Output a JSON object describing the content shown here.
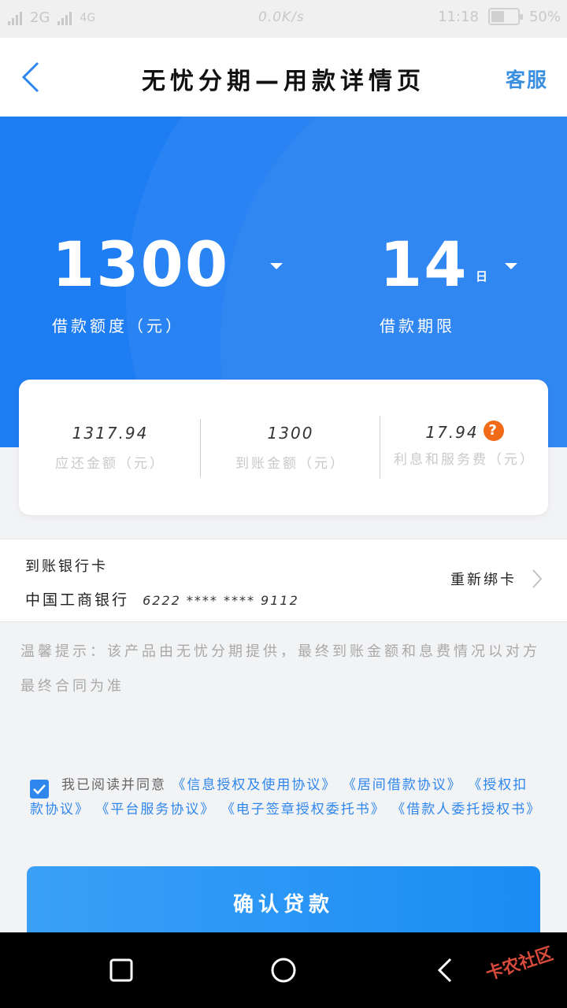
{
  "status_bar": {
    "network_2g": "2G",
    "network_4g": "4G",
    "speed": "0.0K/s",
    "time": "11:18",
    "battery_pct": "50%",
    "battery_level": 0.5
  },
  "nav": {
    "title": "无忧分期—用款详情页",
    "service": "客服",
    "back_icon": "chevron-left-icon"
  },
  "hero": {
    "amount_value": "1300",
    "amount_label": "借款额度（元）",
    "term_value": "14",
    "term_unit": "日",
    "term_label": "借款期限"
  },
  "summary": [
    {
      "value": "1317.94",
      "label": "应还金额（元）"
    },
    {
      "value": "1300",
      "label": "到账金额（元）"
    },
    {
      "value": "17.94",
      "label": "利息和服务费（元）",
      "help": "?"
    }
  ],
  "bank": {
    "title": "到账银行卡",
    "bank_name": "中国工商银行",
    "card_no": "6222 **** **** 9112",
    "rebind": "重新绑卡"
  },
  "tip": "温馨提示：该产品由无忧分期提供，最终到账金额和息费情况以对方最终合同为准",
  "agreement": {
    "checked": true,
    "prefix": "我已阅读并同意",
    "links": [
      "《信息授权及使用协议》",
      "《居间借款协议》",
      "《授权扣款协议》",
      "《平台服务协议》",
      "《电子签章授权委托书》",
      "《借款人委托授权书》"
    ]
  },
  "confirm_button": "确认贷款",
  "watermark": "卡农社区",
  "colors": {
    "primary": "#1e7df2",
    "link": "#2f86ec",
    "help_badge": "#f06a17"
  }
}
